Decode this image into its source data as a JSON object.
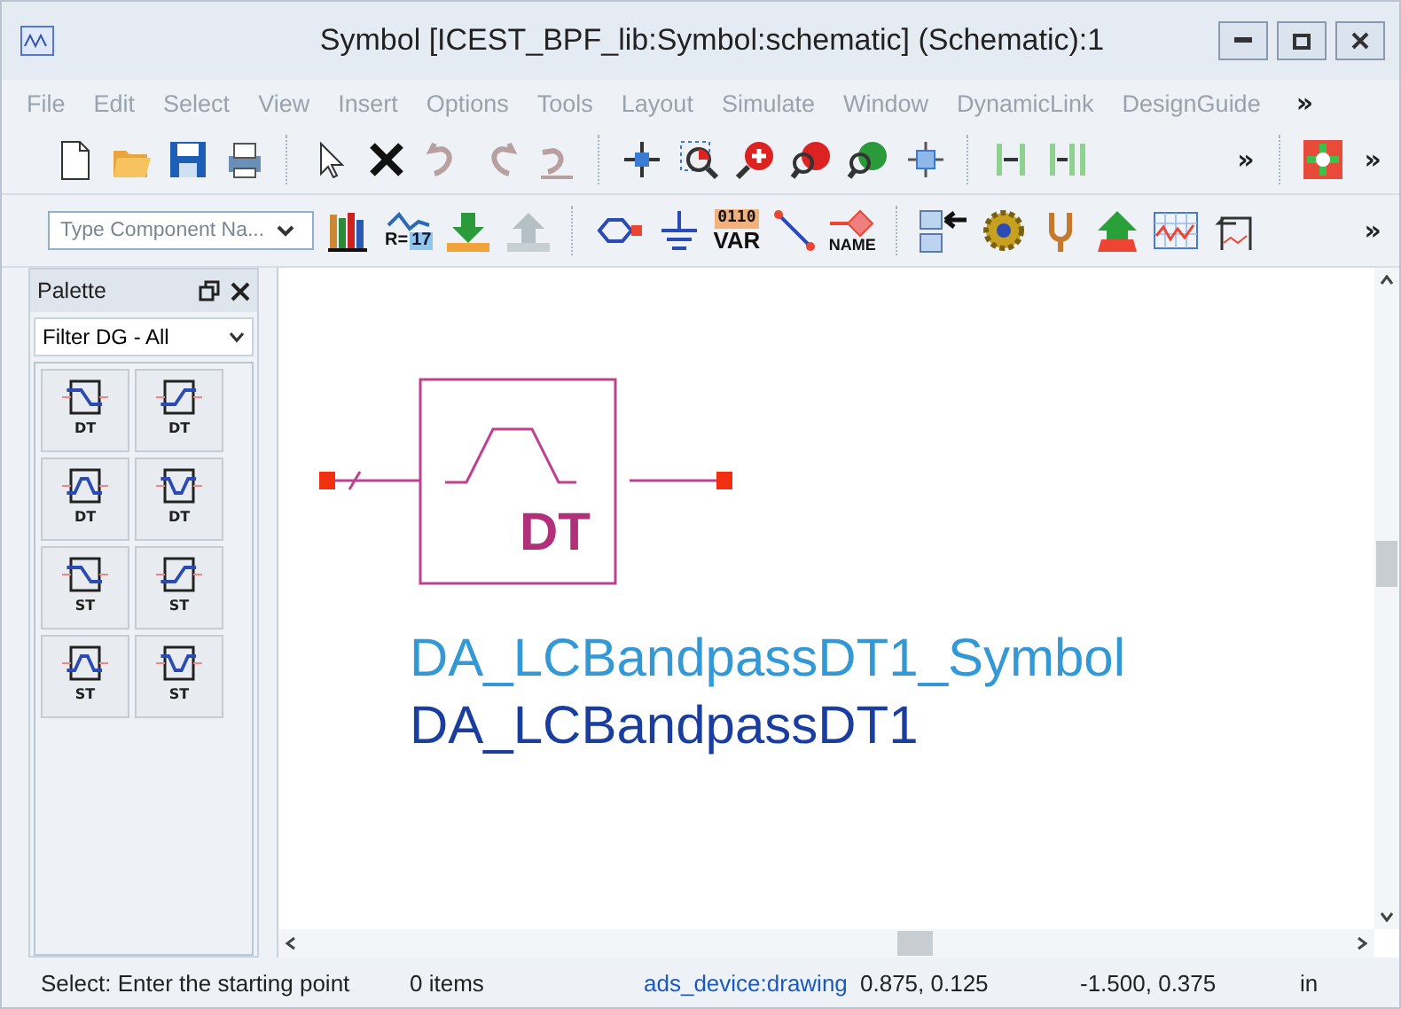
{
  "window": {
    "title": "Symbol [ICEST_BPF_lib:Symbol:schematic] (Schematic):1"
  },
  "menu": {
    "items": [
      "File",
      "Edit",
      "Select",
      "View",
      "Insert",
      "Options",
      "Tools",
      "Layout",
      "Simulate",
      "Window",
      "DynamicLink",
      "DesignGuide"
    ],
    "overflow": "»"
  },
  "toolbar_1": {
    "overflow": [
      "»",
      "»"
    ]
  },
  "toolbar_2": {
    "component_field": {
      "placeholder": "Type Component Na..."
    },
    "equation_label": "R=",
    "equation_value": "17",
    "var_bits": "0110",
    "var_label": "VAR",
    "name_label": "NAME",
    "overflow": "»"
  },
  "palette": {
    "title": "Palette",
    "filter": "Filter DG - All",
    "items": [
      {
        "label": "DT",
        "kind": "lowpass"
      },
      {
        "label": "DT",
        "kind": "highpass"
      },
      {
        "label": "DT",
        "kind": "bandpass"
      },
      {
        "label": "DT",
        "kind": "bandstop"
      },
      {
        "label": "ST",
        "kind": "lowpass"
      },
      {
        "label": "ST",
        "kind": "highpass"
      },
      {
        "label": "ST",
        "kind": "bandpass"
      },
      {
        "label": "ST",
        "kind": "bandstop"
      }
    ]
  },
  "canvas": {
    "symbol_label": "DT",
    "symbol_name": "DA_LCBandpassDT1_Symbol",
    "instance_name": "DA_LCBandpassDT1"
  },
  "status_bar": {
    "prompt": "Select: Enter the starting point",
    "count": "0 items",
    "layer": "ads_device:drawing",
    "position": "0.875, 0.125",
    "offset": "-1.500, 0.375",
    "unit": "in"
  }
}
